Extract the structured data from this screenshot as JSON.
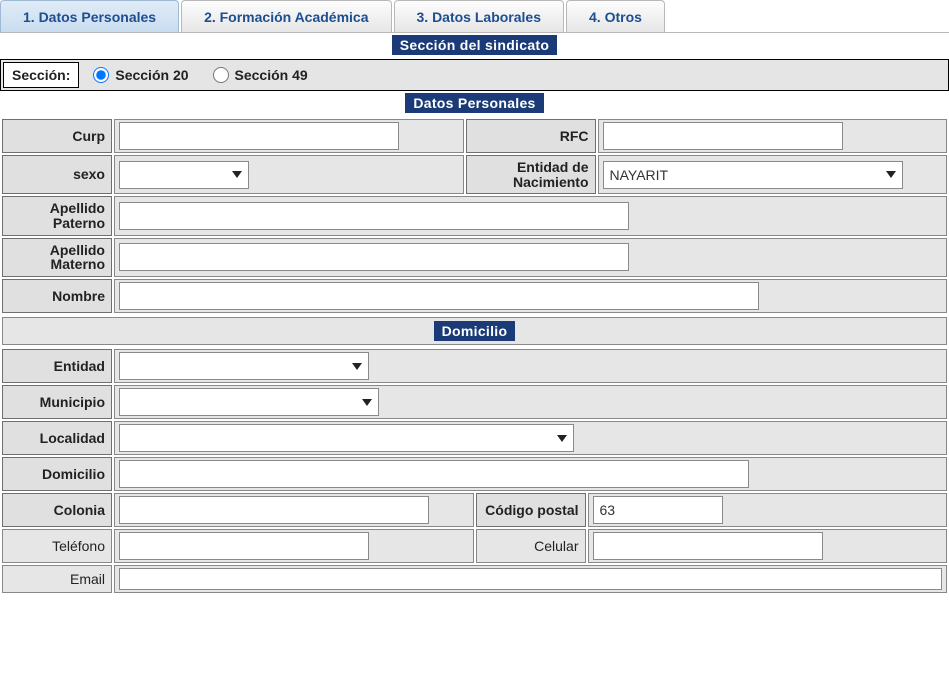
{
  "tabs": {
    "t1": "1. Datos Personales",
    "t2": "2. Formación Académica",
    "t3": "3. Datos Laborales",
    "t4": "4. Otros"
  },
  "section_sindicato": {
    "header": "Sección del sindicato",
    "label": "Sección:",
    "options": {
      "s20": "Sección 20",
      "s49": "Sección 49"
    },
    "selected": "s20"
  },
  "datos_header": "Datos Personales",
  "datos": {
    "curp_label": "Curp",
    "curp": "",
    "rfc_label": "RFC",
    "rfc": "",
    "sexo_label": "sexo",
    "sexo": "",
    "entnac_label": "Entidad de Nacimiento",
    "entnac": "NAYARIT",
    "apat_label": "Apellido Paterno",
    "apat": "",
    "amat_label": "Apellido Materno",
    "amat": "",
    "nombre_label": "Nombre",
    "nombre": ""
  },
  "dom_header": "Domicilio",
  "dom": {
    "entidad_label": "Entidad",
    "entidad": "",
    "municipio_label": "Municipio",
    "municipio": "",
    "localidad_label": "Localidad",
    "localidad": "",
    "domicilio_label": "Domicilio",
    "domicilio": "",
    "colonia_label": "Colonia",
    "colonia": "",
    "cp_label": "Código postal",
    "cp": "63",
    "telefono_label": "Teléfono",
    "telefono": "",
    "celular_label": "Celular",
    "celular": "",
    "email_label": "Email",
    "email": ""
  }
}
